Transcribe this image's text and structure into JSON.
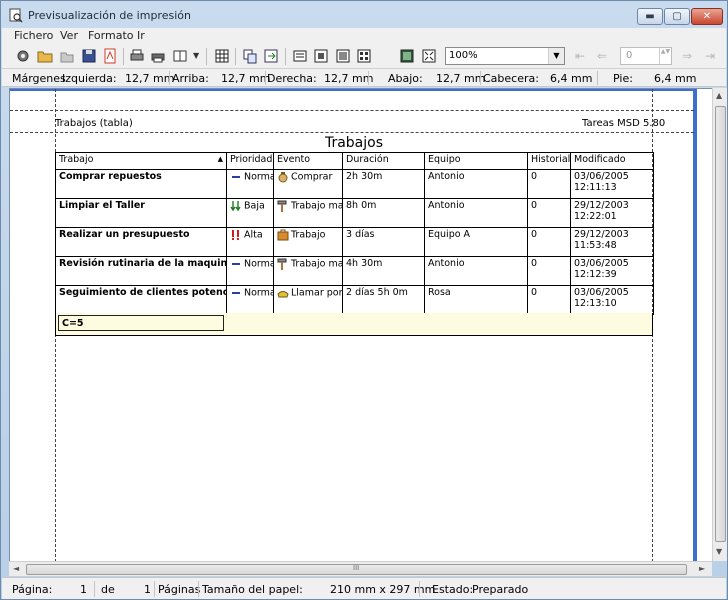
{
  "window": {
    "title": "Previsualización de impresión"
  },
  "window_controls": {
    "minimize": "▬",
    "maximize": "▢",
    "close": "✕"
  },
  "menu": [
    {
      "label": "Fichero"
    },
    {
      "label": "Ver"
    },
    {
      "label": "Formato"
    },
    {
      "label": "Ir"
    }
  ],
  "toolbar": {
    "zoom_value": "100%",
    "page_value": "0",
    "dropdown_glyph": "▼",
    "spin_glyph": "▲▼",
    "first_page_glyph": "⇤",
    "prev_page_glyph": "⇐",
    "next_page_glyph": "⇒",
    "last_page_glyph": "⇥",
    "icons": [
      "settings-icon",
      "open-folder-icon",
      "folder-icon",
      "save-icon",
      "pdf-icon",
      "print-icon",
      "print-setup-icon",
      "book-icon",
      "grid-icon",
      "copy-pages-icon",
      "export-icon",
      "page-width-icon",
      "one-page-icon",
      "two-pages-icon",
      "multi-pages-icon",
      "full-screen-icon",
      "fit-icon"
    ]
  },
  "margins": {
    "label": "Márgenes",
    "left_label": "Izquierda:",
    "left_value": "12,7 mm",
    "top_label": "Arriba:",
    "top_value": "12,7 mm",
    "right_label": "Derecha:",
    "right_value": "12,7 mm",
    "bottom_label": "Abajo:",
    "bottom_value": "12,7 mm",
    "header_label": "Cabecera:",
    "header_value": "6,4 mm",
    "footer_label": "Pie:",
    "footer_value": "6,4 mm"
  },
  "report": {
    "header_left": "Trabajos (tabla)",
    "header_right": "Tareas MSD 5.80",
    "title": "Trabajos",
    "columns": [
      "Trabajo",
      "Prioridad",
      "Evento",
      "Duración",
      "Equipo",
      "Historial",
      "Modificado"
    ],
    "sort_glyph": "▲",
    "rows": [
      {
        "trabajo": "Comprar repuestos",
        "prioridad": "Normal",
        "prioridad_icon": "dash-icon",
        "evento": "Comprar",
        "evento_icon": "money-bag-icon",
        "duracion": "2h 30m",
        "equipo": "Antonio",
        "historial": "0",
        "fecha": "03/06/2005",
        "hora": "12:11:13"
      },
      {
        "trabajo": "Limpiar el Taller",
        "prioridad": "Baja",
        "prioridad_icon": "down-arrows-icon",
        "evento": "Trabajo man",
        "evento_icon": "hammer-icon",
        "duracion": "8h 0m",
        "equipo": "Antonio",
        "historial": "0",
        "fecha": "29/12/2003",
        "hora": "12:22:01"
      },
      {
        "trabajo": "Realizar un presupuesto",
        "prioridad": "Alta",
        "prioridad_icon": "exclamation-icon",
        "evento": "Trabajo",
        "evento_icon": "briefcase-icon",
        "duracion": "3 días",
        "equipo": "Equipo A",
        "historial": "0",
        "fecha": "29/12/2003",
        "hora": "11:53:48"
      },
      {
        "trabajo": "Revisión rutinaria de la maquinaria",
        "prioridad": "Normal",
        "prioridad_icon": "dash-icon",
        "evento": "Trabajo man",
        "evento_icon": "hammer-icon",
        "duracion": "4h 30m",
        "equipo": "Antonio",
        "historial": "0",
        "fecha": "03/06/2005",
        "hora": "12:12:39"
      },
      {
        "trabajo": "Seguimiento de clientes potenciales",
        "prioridad": "Normal",
        "prioridad_icon": "dash-icon",
        "evento": "Llamar por t",
        "evento_icon": "phone-icon",
        "duracion": "2 días 5h 0m",
        "equipo": "Rosa",
        "historial": "0",
        "fecha": "03/06/2005",
        "hora": "12:13:10"
      }
    ],
    "total": "C=5"
  },
  "scrollbars": {
    "up": "▲",
    "down": "▼",
    "left": "◄",
    "right": "►",
    "grip": "III"
  },
  "status": {
    "page_label": "Página:",
    "page_value": "1",
    "of_label": "de",
    "pages_value": "1",
    "pages_label": "Páginas",
    "paper_label": "Tamaño del papel:",
    "paper_value": "210 mm x 297 mm",
    "state_label": "Estado:",
    "state_value": "Preparado"
  },
  "colors": {
    "page_edge": "#3c6ed0",
    "total_row": "#fdfbe0",
    "pdf_red": "#d03a2a"
  }
}
